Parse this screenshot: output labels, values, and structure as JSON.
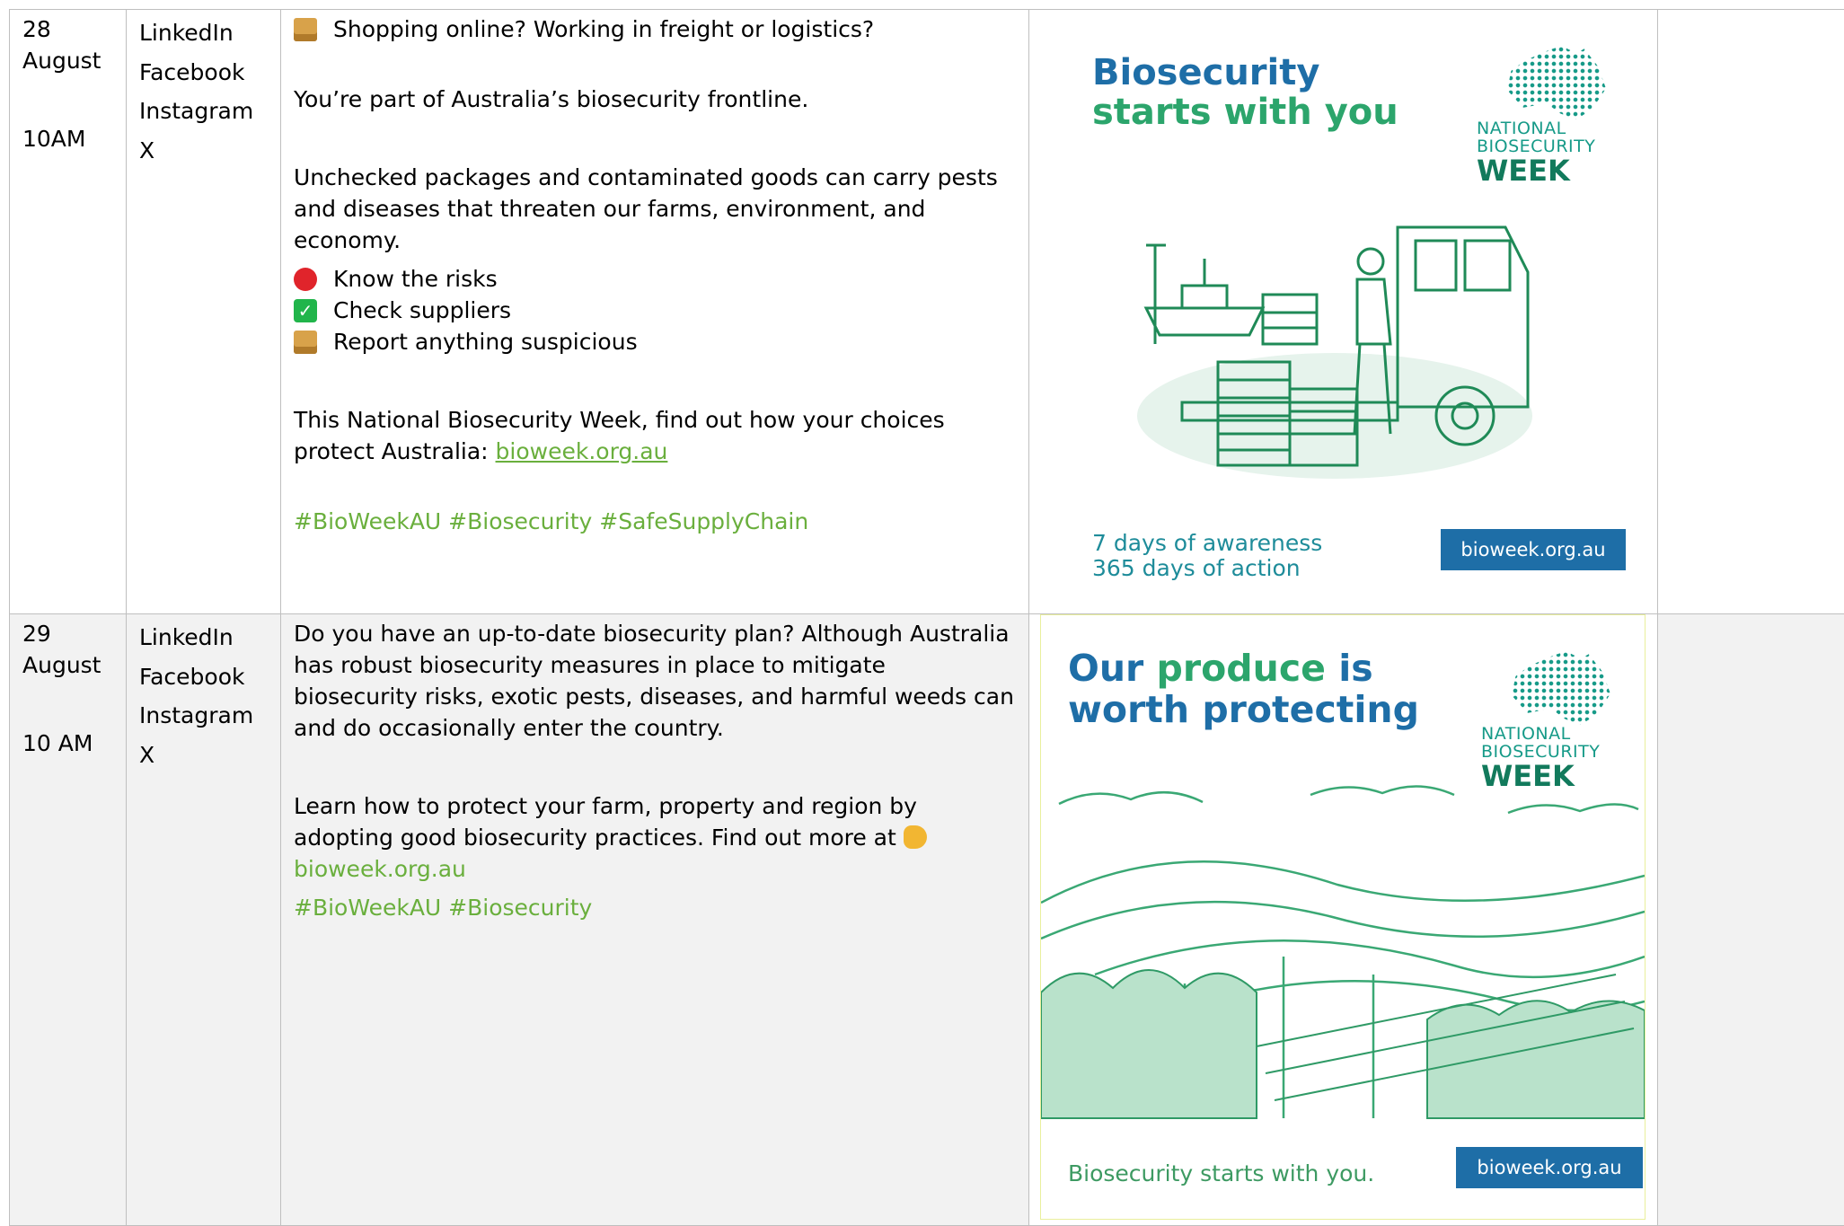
{
  "rows": [
    {
      "date_day": "28",
      "date_month": "August",
      "time": "10AM",
      "channels": [
        "LinkedIn",
        "Facebook",
        "Instagram",
        "X"
      ],
      "copy": {
        "line1": "Shopping online? Working in freight or logistics?",
        "line2": "You’re part of Australia’s biosecurity frontline.",
        "line3": "Unchecked packages and contaminated goods can carry pests and diseases that threaten our farms, environment, and economy.",
        "bullets": [
          "Know the risks",
          "Check suppliers",
          "Report anything suspicious"
        ],
        "line4": "This National Biosecurity Week, find out how your choices protect Australia: ",
        "link": "bioweek.org.au",
        "hashtags": "#BioWeekAU #Biosecurity #SafeSupplyChain"
      },
      "creative": {
        "headline_1": "Biosecurity",
        "headline_2": "starts with you",
        "logo_1": "NATIONAL",
        "logo_2": "BIOSECURITY",
        "logo_3": "WEEK",
        "footer_1": "7 days of awareness",
        "footer_2": "365 days of action",
        "cta": "bioweek.org.au"
      }
    },
    {
      "date_day": "29",
      "date_month": "August",
      "time": "10 AM",
      "channels": [
        "LinkedIn",
        "Facebook",
        "Instagram",
        "X"
      ],
      "copy": {
        "para1": "Do you have an up-to-date biosecurity plan? Although Australia has robust biosecurity measures in place to mitigate biosecurity risks, exotic pests, diseases, and harmful weeds can and do occasionally enter the country.",
        "para2": "Learn how to protect your farm, property and region by adopting good biosecurity practices. Find out more at ",
        "link": "bioweek.org.au",
        "hashtags": "#BioWeekAU #Biosecurity"
      },
      "creative": {
        "headline_a": "Our ",
        "headline_b": "produce",
        "headline_c": " is",
        "headline_2": "worth protecting",
        "logo_1": "NATIONAL",
        "logo_2": "BIOSECURITY",
        "logo_3": "WEEK",
        "footer": "Biosecurity starts with you.",
        "cta": "bioweek.org.au"
      }
    }
  ],
  "colors": {
    "brand_blue": "#1e6ea7",
    "brand_green": "#2ca56c",
    "link_green": "#6aaf3d",
    "illustration_green": "#1f8a57"
  },
  "icons": [
    "package-emoji",
    "stop-sign-emoji",
    "check-mark-emoji",
    "pointing-hand-emoji"
  ]
}
